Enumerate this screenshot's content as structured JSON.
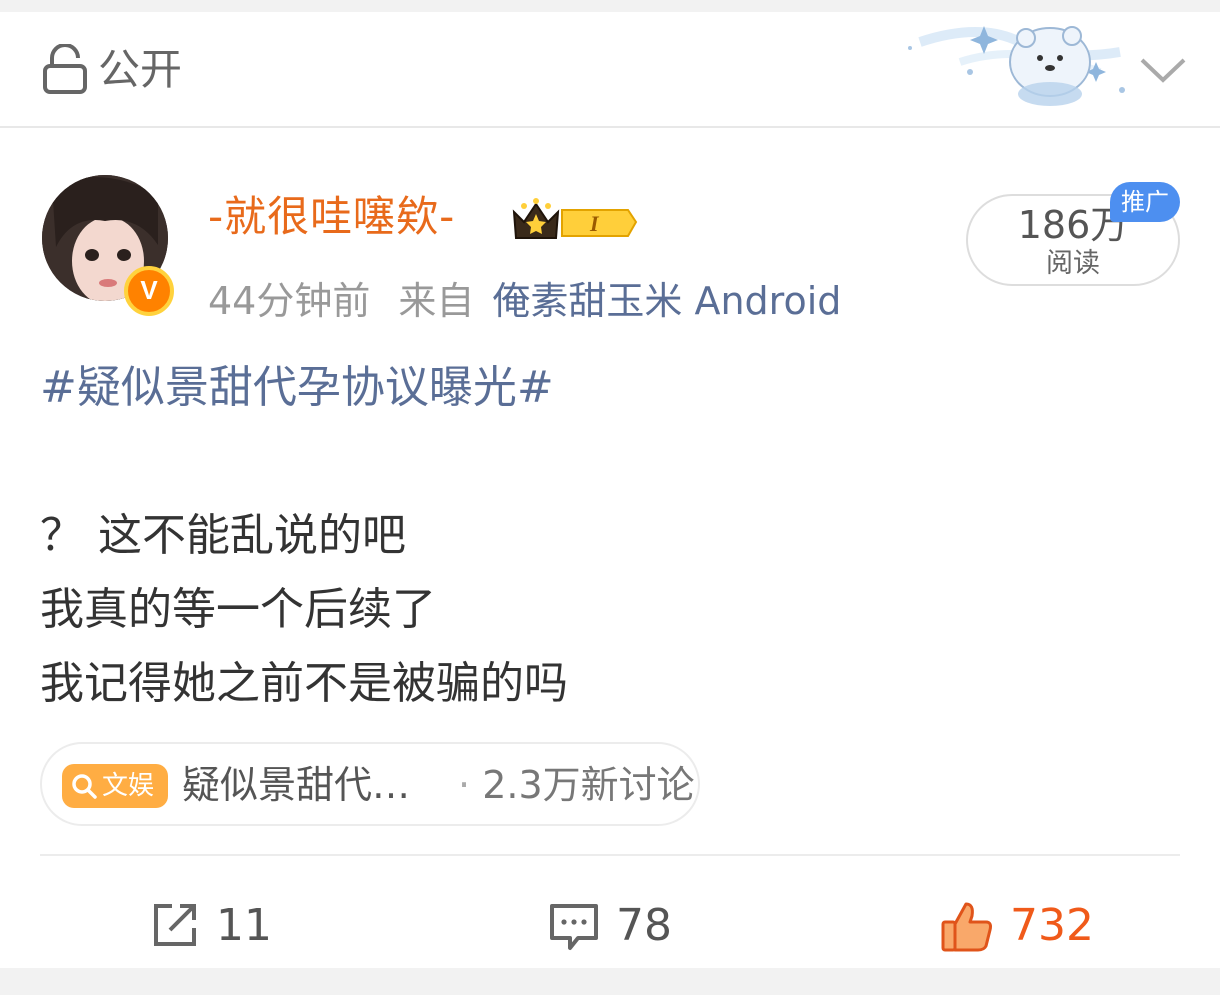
{
  "header": {
    "privacy_label": "公开",
    "lock_icon": "lock-icon",
    "expand_icon": "chevron-down-icon"
  },
  "post": {
    "username": "-就很哇噻欸-",
    "time": "44分钟前",
    "from_label": "来自",
    "source": "俺素甜玉米 Android",
    "reads": {
      "count": "186万",
      "label": "阅读",
      "promo_label": "推广"
    },
    "hashtag": "#疑似景甜代孕协议曝光#",
    "lines": [
      "？ 这不能乱说的吧",
      "我真的等一个后续了",
      "我记得她之前不是被骗的吗"
    ],
    "topic": {
      "tag": "文娱",
      "title": "疑似景甜代…",
      "separator": "·",
      "count": "2.3万新讨论"
    }
  },
  "actions": {
    "repost_count": "11",
    "comment_count": "78",
    "like_count": "732"
  },
  "colors": {
    "username": "#e86a1b",
    "link": "#5a6e96",
    "like": "#f05a1a",
    "promo": "#4d8ff0",
    "topic_tag": "#ffad43"
  }
}
